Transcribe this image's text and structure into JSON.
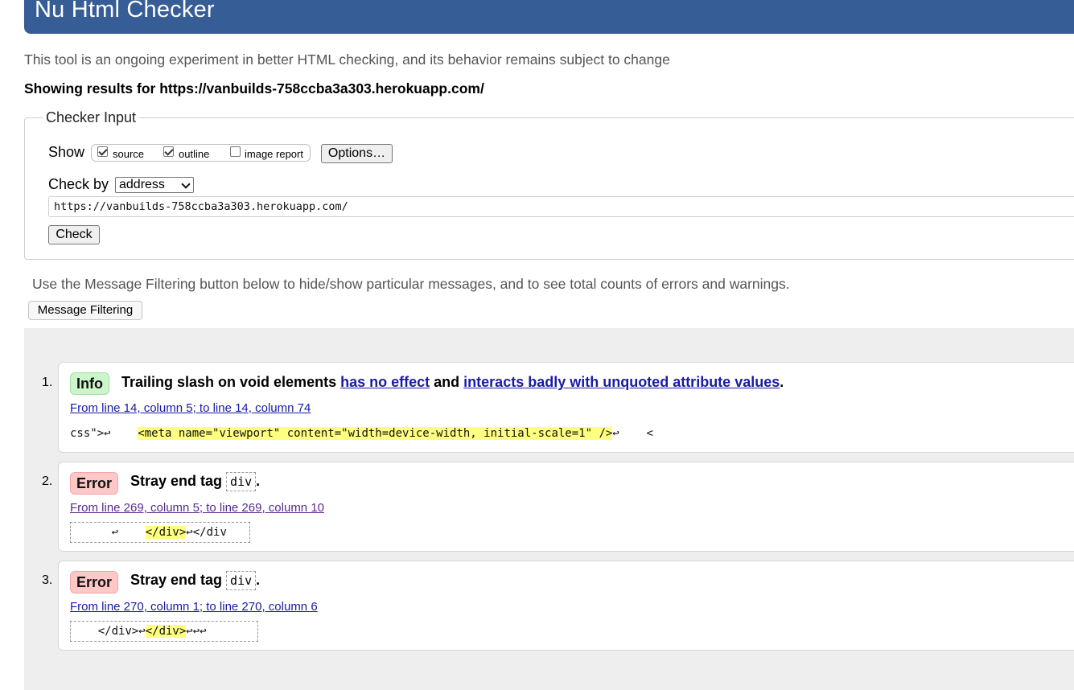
{
  "header": {
    "title": "Nu Html Checker"
  },
  "tagline": "This tool is an ongoing experiment in better HTML checking, and its behavior remains subject to change",
  "results_for": "Showing results for https://vanbuilds-758ccba3a303.herokuapp.com/",
  "checker_input": {
    "legend": "Checker Input",
    "show_label": "Show",
    "options": [
      {
        "label": "source",
        "checked": true
      },
      {
        "label": "outline",
        "checked": true
      },
      {
        "label": "image report",
        "checked": false
      }
    ],
    "options_button": "Options…",
    "check_by_label": "Check by",
    "check_by_value": "address",
    "url_value": "https://vanbuilds-758ccba3a303.herokuapp.com/",
    "check_button": "Check"
  },
  "filter": {
    "hint": "Use the Message Filtering button below to hide/show particular messages, and to see total counts of errors and warnings.",
    "button": "Message Filtering"
  },
  "messages": [
    {
      "number": "1.",
      "type": "Info",
      "text_before": "Trailing slash on void elements",
      "link1": "has no effect",
      "text_mid": "and",
      "link2": "interacts badly with unquoted attribute values",
      "text_after": ".",
      "location": "From line 14, column 5; to line 14, column 74",
      "extract_pre": "css\">↩    ",
      "extract_hl": "<meta name=\"viewport\" content=\"width=device-width, initial-scale=1\" />",
      "extract_post": "↩    <"
    },
    {
      "number": "2.",
      "type": "Error",
      "text_before": "Stray end tag",
      "code": "div",
      "text_after": ".",
      "location": "From line 269, column 5; to line 269, column 10",
      "extract_pre": "      ↩    ",
      "extract_hl": "</div>",
      "extract_post": "↩</div"
    },
    {
      "number": "3.",
      "type": "Error",
      "text_before": "Stray end tag",
      "code": "div",
      "text_after": ".",
      "location": "From line 270, column 1; to line 270, column 6",
      "extract_pre": "    </div>↩",
      "extract_hl": "</div>",
      "extract_post": "↩↩↩"
    }
  ],
  "colors": {
    "banner": "#365d95",
    "info_badge": "#ccf5cc",
    "error_badge": "#ffc8c8",
    "highlight": "#ffff80",
    "link": "#1a1aa6"
  }
}
